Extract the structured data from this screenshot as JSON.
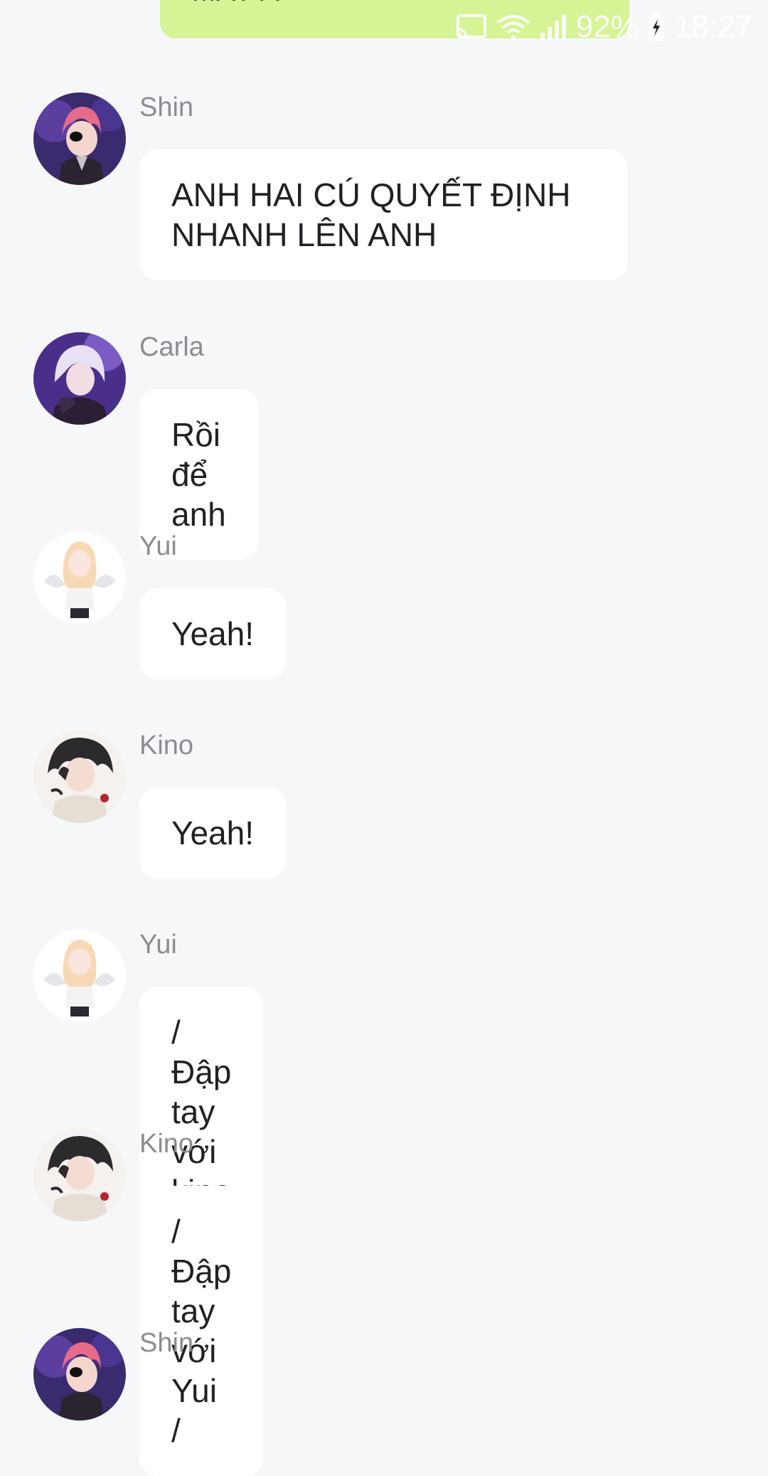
{
  "status_bar": {
    "battery": "92%",
    "time": "18:27"
  },
  "top_partial_message": {
    "text": "MAY A"
  },
  "messages": [
    {
      "sender": "Shin",
      "text": "ANH HAI CÚ QUYẾT ĐỊNH\nNHANH LÊN ANH"
    },
    {
      "sender": "Carla",
      "text": "Rồi để anh"
    },
    {
      "sender": "Yui",
      "text": "Yeah!"
    },
    {
      "sender": "Kino",
      "text": "Yeah!"
    },
    {
      "sender": "Yui",
      "text": "/ Đập tay với kino /"
    },
    {
      "sender": "Kino",
      "text": "/ Đập tay với Yui /"
    },
    {
      "sender": "Shin",
      "text": ""
    }
  ],
  "colors": {
    "background": "#f6f7f9",
    "own_bubble": "#d6f495",
    "other_bubble": "#ffffff",
    "sender_name": "#8a8d92"
  }
}
